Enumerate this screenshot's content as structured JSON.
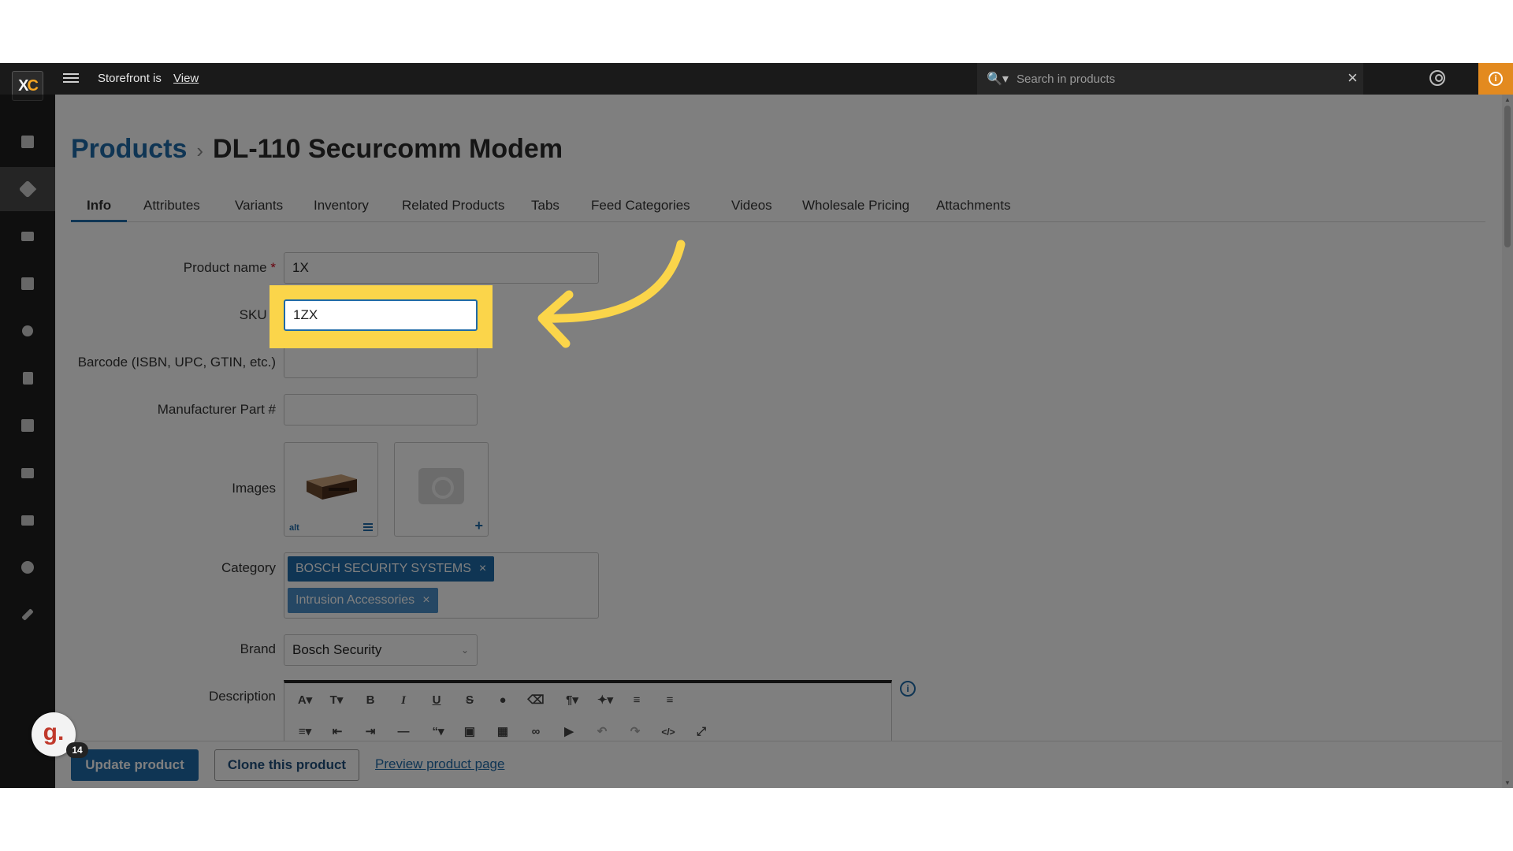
{
  "topbar": {
    "storefront_label": "Storefront is",
    "storefront_view": "View",
    "search_placeholder": "Search in products"
  },
  "sidebar": {
    "items": [
      "list-icon",
      "tag-icon",
      "envelope-icon",
      "gift-icon",
      "sitemap-icon",
      "file-icon",
      "puzzle-icon",
      "image-icon",
      "store-icon",
      "gear-icon",
      "wrench-icon"
    ]
  },
  "breadcrumb": {
    "root": "Products",
    "separator": "›",
    "title": "DL-110 Securcomm Modem"
  },
  "tabs": [
    "Info",
    "Attributes",
    "Variants",
    "Inventory",
    "Related Products",
    "Tabs",
    "Feed Categories",
    "Videos",
    "Wholesale Pricing",
    "Attachments"
  ],
  "form": {
    "product_name_label": "Product name",
    "product_name_value": "1X",
    "sku_label": "SKU",
    "sku_value": "1ZX",
    "barcode_label": "Barcode (ISBN, UPC, GTIN, etc.)",
    "barcode_value": "",
    "mpn_label": "Manufacturer Part #",
    "mpn_value": "",
    "images_label": "Images",
    "image_alt": "alt",
    "category_label": "Category",
    "categories": [
      "BOSCH SECURITY SYSTEMS",
      "Intrusion Accessories"
    ],
    "brand_label": "Brand",
    "brand_value": "Bosch Security",
    "description_label": "Description",
    "required_mark": "*"
  },
  "actions": {
    "update": "Update product",
    "clone": "Clone this product",
    "preview": "Preview product page"
  },
  "chat": {
    "logo_letter": "g.",
    "count": "14"
  },
  "colors": {
    "accent": "#1f6aa8",
    "highlight": "#fbd54a",
    "info_orange": "#e38a1f"
  }
}
